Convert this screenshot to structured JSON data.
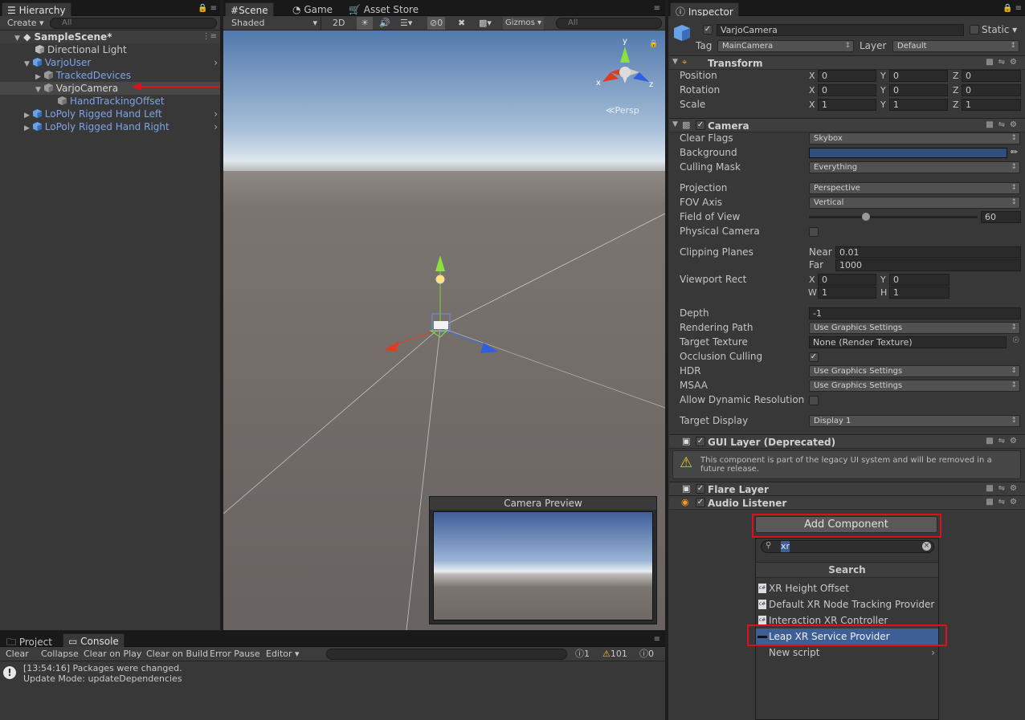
{
  "hierarchy": {
    "tab": "Hierarchy",
    "create": "Create",
    "search_placeholder": "All",
    "scene": "SampleScene*",
    "items": [
      {
        "label": "Directional Light"
      },
      {
        "label": "VarjoUser"
      },
      {
        "label": "TrackedDevices"
      },
      {
        "label": "VarjoCamera"
      },
      {
        "label": "HandTrackingOffset"
      },
      {
        "label": "LoPoly Rigged Hand Left"
      },
      {
        "label": "LoPoly Rigged Hand Right"
      }
    ]
  },
  "scene_view": {
    "tabs": [
      "Scene",
      "Game",
      "Asset Store"
    ],
    "shading": "Shaded",
    "mode_2d": "2D",
    "hidden_count": "0",
    "gizmos": "Gizmos",
    "search_placeholder": "All",
    "gizmo_axes": {
      "x": "x",
      "y": "y",
      "z": "z"
    },
    "persp": "Persp",
    "camera_preview_title": "Camera Preview"
  },
  "console": {
    "tabs": [
      "Project",
      "Console"
    ],
    "buttons": [
      "Clear",
      "Collapse",
      "Clear on Play",
      "Clear on Build",
      "Error Pause",
      "Editor"
    ],
    "log_count": "1",
    "warn_count": "101",
    "error_count": "0",
    "messages": [
      "[13:54:16] Packages were changed.",
      "Update Mode: updateDependencies"
    ]
  },
  "inspector": {
    "tab": "Inspector",
    "object_name": "VarjoCamera",
    "static_label": "Static",
    "tag_label": "Tag",
    "tag_value": "MainCamera",
    "layer_label": "Layer",
    "layer_value": "Default",
    "transform": {
      "title": "Transform",
      "rows": [
        {
          "label": "Position",
          "x": "0",
          "y": "0",
          "z": "0"
        },
        {
          "label": "Rotation",
          "x": "0",
          "y": "0",
          "z": "0"
        },
        {
          "label": "Scale",
          "x": "1",
          "y": "1",
          "z": "1"
        }
      ]
    },
    "camera": {
      "title": "Camera",
      "clear_flags_label": "Clear Flags",
      "clear_flags": "Skybox",
      "background_label": "Background",
      "background_color": "#314d79",
      "culling_mask_label": "Culling Mask",
      "culling_mask": "Everything",
      "projection_label": "Projection",
      "projection": "Perspective",
      "fov_axis_label": "FOV Axis",
      "fov_axis": "Vertical",
      "fov_label": "Field of View",
      "fov": "60",
      "physical_label": "Physical Camera",
      "clipping_label": "Clipping Planes",
      "near_label": "Near",
      "near": "0.01",
      "far_label": "Far",
      "far": "1000",
      "viewport_label": "Viewport Rect",
      "vp_x": "0",
      "vp_y": "0",
      "vp_w": "1",
      "vp_h": "1",
      "depth_label": "Depth",
      "depth": "-1",
      "rendering_path_label": "Rendering Path",
      "rendering_path": "Use Graphics Settings",
      "target_texture_label": "Target Texture",
      "target_texture": "None (Render Texture)",
      "occlusion_label": "Occlusion Culling",
      "hdr_label": "HDR",
      "hdr": "Use Graphics Settings",
      "msaa_label": "MSAA",
      "msaa": "Use Graphics Settings",
      "dynamic_res_label": "Allow Dynamic Resolution",
      "target_display_label": "Target Display",
      "target_display": "Display 1"
    },
    "gui_layer": {
      "title": "GUI Layer (Deprecated)",
      "warning": "This component is part of the legacy UI system and will be removed in a future release."
    },
    "flare_layer": "Flare Layer",
    "audio_listener": "Audio Listener",
    "add_component": "Add Component",
    "search_query": "xr",
    "search_header": "Search",
    "results": [
      "XR Height Offset",
      "Default XR Node Tracking Provider",
      "Interaction XR Controller",
      "Leap XR Service Provider",
      "New script"
    ]
  },
  "colors": {
    "highlight": "#e0101a",
    "selection": "#3e5f96",
    "link": "#7ea3e6"
  }
}
